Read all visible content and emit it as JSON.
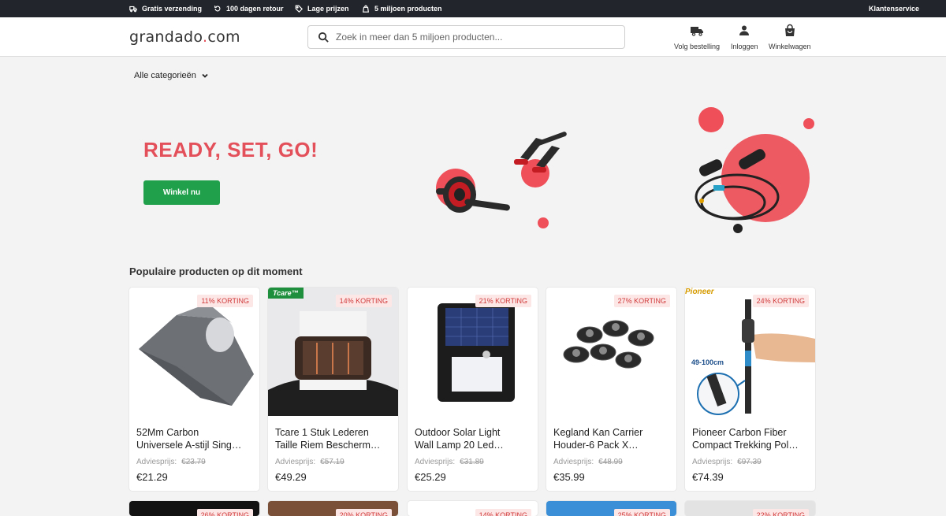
{
  "topbar": {
    "usps": [
      {
        "label": "Gratis verzending",
        "icon": "truck-icon"
      },
      {
        "label": "100 dagen retour",
        "icon": "return-icon"
      },
      {
        "label": "Lage prijzen",
        "icon": "price-tag-icon"
      },
      {
        "label": "5 miljoen producten",
        "icon": "bag-icon"
      }
    ],
    "service_label": "Klantenservice"
  },
  "header": {
    "logo_text": "grandado",
    "logo_dot": ".",
    "logo_tld": "com",
    "search_placeholder": "Zoek in meer dan 5 miljoen producten...",
    "actions": [
      {
        "label": "Volg bestelling",
        "icon": "truck-icon"
      },
      {
        "label": "Inloggen",
        "icon": "user-icon"
      },
      {
        "label": "Winkelwagen",
        "icon": "shopping-bag-icon"
      }
    ]
  },
  "categories_label": "Alle categorieën",
  "hero": {
    "title": "READY, SET, GO!",
    "button_label": "Winkel nu"
  },
  "section_title": "Populaire producten op dit moment",
  "rrp_label": "Adviesprijs:",
  "products": [
    {
      "discount": "11% KORTING",
      "name1": "52Mm Carbon",
      "name2": "Universele A-stijl Sing…",
      "rrp": "€23.79",
      "price": "€21.29"
    },
    {
      "discount": "14% KORTING",
      "name1": "Tcare 1 Stuk Lederen",
      "name2": "Taille Riem Bescherm…",
      "rrp": "€57.19",
      "price": "€49.29",
      "brand_tag": "Tcare™"
    },
    {
      "discount": "21% KORTING",
      "name1": "Outdoor Solar Light",
      "name2": "Wall Lamp 20 Led…",
      "rrp": "€31.89",
      "price": "€25.29"
    },
    {
      "discount": "27% KORTING",
      "name1": "Kegland Kan Carrier",
      "name2": "Houder-6 Pack X…",
      "rrp": "€48.99",
      "price": "€35.99"
    },
    {
      "discount": "24% KORTING",
      "name1": "Pioneer Carbon Fiber",
      "name2": "Compact Trekking Pol…",
      "rrp": "€97.39",
      "price": "€74.39",
      "brand_tag": "Pioneer",
      "dimension": "49-100cm"
    }
  ],
  "products_row2": [
    {
      "discount": "26% KORTING"
    },
    {
      "discount": "20% KORTING"
    },
    {
      "discount": "14% KORTING"
    },
    {
      "discount": "25% KORTING"
    },
    {
      "discount": "22% KORTING"
    }
  ],
  "colors": {
    "accent": "#e4505a",
    "button": "#20a04b",
    "topbar": "#22252b"
  }
}
